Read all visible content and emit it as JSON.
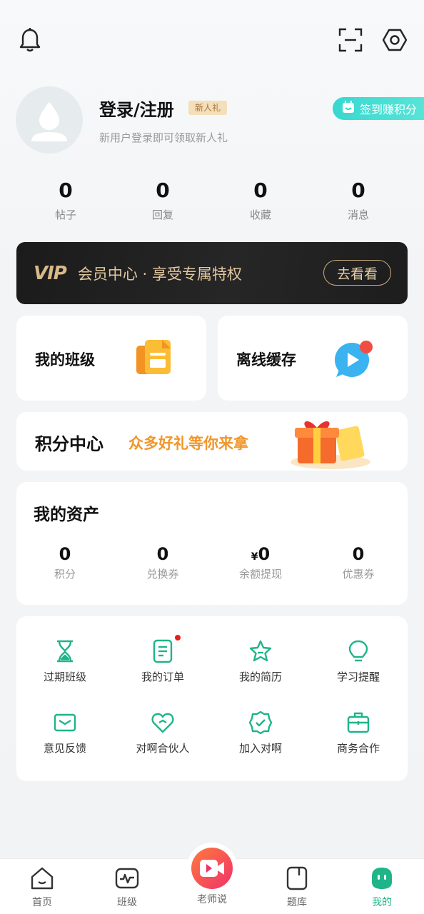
{
  "header": {
    "bell_icon": "bell-icon",
    "scan_icon": "scan-icon",
    "settings_icon": "settings-hexagon-icon"
  },
  "profile": {
    "login_label": "登录/注册",
    "badge": "新人礼",
    "hint": "新用户登录即可领取新人礼",
    "checkin_label": "签到赚积分"
  },
  "stats": [
    {
      "value": "0",
      "label": "帖子"
    },
    {
      "value": "0",
      "label": "回复"
    },
    {
      "value": "0",
      "label": "收藏"
    },
    {
      "value": "0",
      "label": "消息"
    }
  ],
  "vip": {
    "logo": "VIP",
    "title": "会员中心 · 享受专属特权",
    "button": "去看看"
  },
  "quick_cards": {
    "my_class": "我的班级",
    "offline": "离线缓存"
  },
  "points": {
    "title": "积分中心",
    "subtitle": "众多好礼等你来拿"
  },
  "assets": {
    "title": "我的资产",
    "items": [
      {
        "value": "0",
        "prefix": "",
        "label": "积分"
      },
      {
        "value": "0",
        "prefix": "",
        "label": "兑换券"
      },
      {
        "value": "0",
        "prefix": "¥",
        "label": "余额提现"
      },
      {
        "value": "0",
        "prefix": "",
        "label": "优惠券"
      }
    ]
  },
  "tools": [
    {
      "label": "过期班级",
      "icon": "hourglass-icon"
    },
    {
      "label": "我的订单",
      "icon": "order-icon"
    },
    {
      "label": "我的简历",
      "icon": "star-icon"
    },
    {
      "label": "学习提醒",
      "icon": "bulb-icon"
    },
    {
      "label": "意见反馈",
      "icon": "mail-icon"
    },
    {
      "label": "对啊合伙人",
      "icon": "heart-icon"
    },
    {
      "label": "加入对啊",
      "icon": "check-badge-icon"
    },
    {
      "label": "商务合作",
      "icon": "briefcase-icon"
    }
  ],
  "colors": {
    "accent": "#1fb489",
    "vip_gold": "#d8b98a",
    "points_orange": "#f0962b"
  },
  "nav": {
    "home": "首页",
    "class": "班级",
    "teacher": "老师说",
    "question_bank": "题库",
    "mine": "我的"
  }
}
